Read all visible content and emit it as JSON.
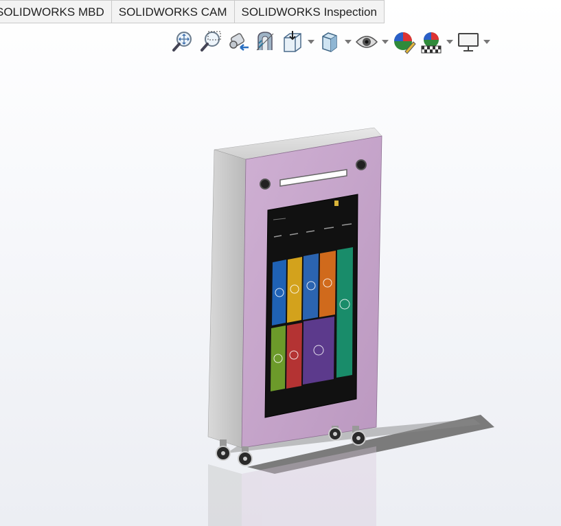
{
  "tabs": [
    {
      "label": "SOLIDWORKS MBD"
    },
    {
      "label": "SOLIDWORKS CAM"
    },
    {
      "label": "SOLIDWORKS Inspection"
    }
  ],
  "toolbar": {
    "icons": [
      "zoom-to-fit-icon",
      "zoom-to-area-icon",
      "previous-view-icon",
      "section-view-icon",
      "view-orientation-icon",
      "display-style-icon",
      "hide-show-items-icon",
      "edit-appearance-icon",
      "apply-scene-icon",
      "view-settings-icon"
    ]
  },
  "model": {
    "screen_tiles": [
      {
        "color": "#1f62b5"
      },
      {
        "color": "#d3a21c"
      },
      {
        "color": "#2b64b0"
      },
      {
        "color": "#d06a1c"
      },
      {
        "color": "#198c6a"
      },
      {
        "color": "#6c9a2a"
      },
      {
        "color": "#b43333"
      },
      {
        "color": "#5c3a8c"
      }
    ],
    "colors": {
      "bezel": "#c8a6cc",
      "housing": "#c9c9c9",
      "screen": "#111111"
    }
  }
}
